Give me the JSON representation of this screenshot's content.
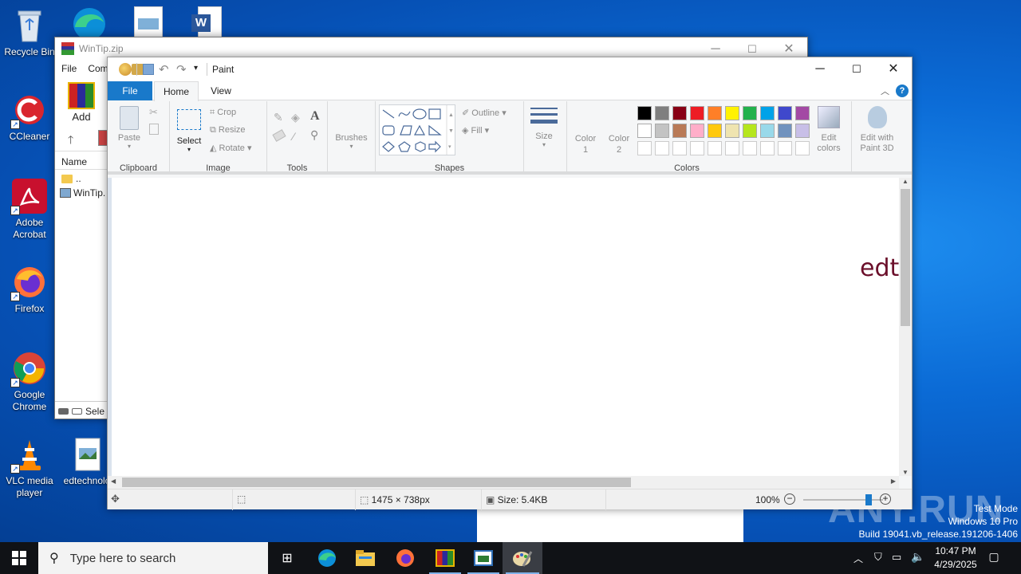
{
  "desktop": {
    "icons": [
      {
        "label": "Recycle Bin",
        "icon": "recycle-bin-icon"
      },
      {
        "label": "CCleaner",
        "icon": "ccleaner-icon"
      },
      {
        "label": "Adobe Acrobat",
        "icon": "adobe-acrobat-icon"
      },
      {
        "label": "Firefox",
        "icon": "firefox-icon"
      },
      {
        "label": "Google Chrome",
        "icon": "chrome-icon"
      },
      {
        "label": "VLC media player",
        "icon": "vlc-icon"
      },
      {
        "label": "edtechnolo",
        "icon": "image-file-icon"
      }
    ],
    "watermark": {
      "line1": "Test Mode",
      "line2": "Windows 10 Pro",
      "line3": "Build 19041.vb_release.191206-1406",
      "brand": "ANY.RUN"
    }
  },
  "winrar": {
    "title": "WinTip.zip",
    "menu": [
      "File",
      "Com"
    ],
    "toolbar_add": "Add",
    "column_name": "Name",
    "rows": [
      "..",
      "WinTip."
    ],
    "status": "Sele"
  },
  "paint": {
    "title": "Paint",
    "tabs": [
      "File",
      "Home",
      "View"
    ],
    "clipboard": {
      "paste": "Paste",
      "group": "Clipboard"
    },
    "image": {
      "select": "Select",
      "crop": "Crop",
      "resize": "Resize",
      "rotate": "Rotate",
      "group": "Image"
    },
    "tools": {
      "group": "Tools"
    },
    "brushes": {
      "label": "Brushes"
    },
    "shapes": {
      "outline": "Outline",
      "fill": "Fill",
      "group": "Shapes"
    },
    "size": {
      "label": "Size"
    },
    "color1": {
      "line1": "Color",
      "line2": "1"
    },
    "color2": {
      "line1": "Color",
      "line2": "2"
    },
    "edit_colors": {
      "line1": "Edit",
      "line2": "colors"
    },
    "edit3d": {
      "line1": "Edit with",
      "line2": "Paint 3D"
    },
    "colors_group": "Colors",
    "palette_row1": [
      "#000000",
      "#7f7f7f",
      "#880015",
      "#ed1c24",
      "#ff7f27",
      "#fff200",
      "#22b14c",
      "#00a2e8",
      "#3f48cc",
      "#a349a4"
    ],
    "palette_row2": [
      "#ffffff",
      "#c3c3c3",
      "#b97a57",
      "#ffaec9",
      "#ffc90e",
      "#efe4b0",
      "#b5e61d",
      "#99d9ea",
      "#7092be",
      "#c8bfe7"
    ],
    "canvas_text": "edt",
    "canvas_text_color": "#6b0f2a",
    "status": {
      "dimensions": "1475 × 738px",
      "size": "Size: 5.4KB",
      "zoom": "100%"
    }
  },
  "taskbar": {
    "search_placeholder": "Type here to search",
    "time": "10:47 PM",
    "date": "4/29/2025"
  }
}
